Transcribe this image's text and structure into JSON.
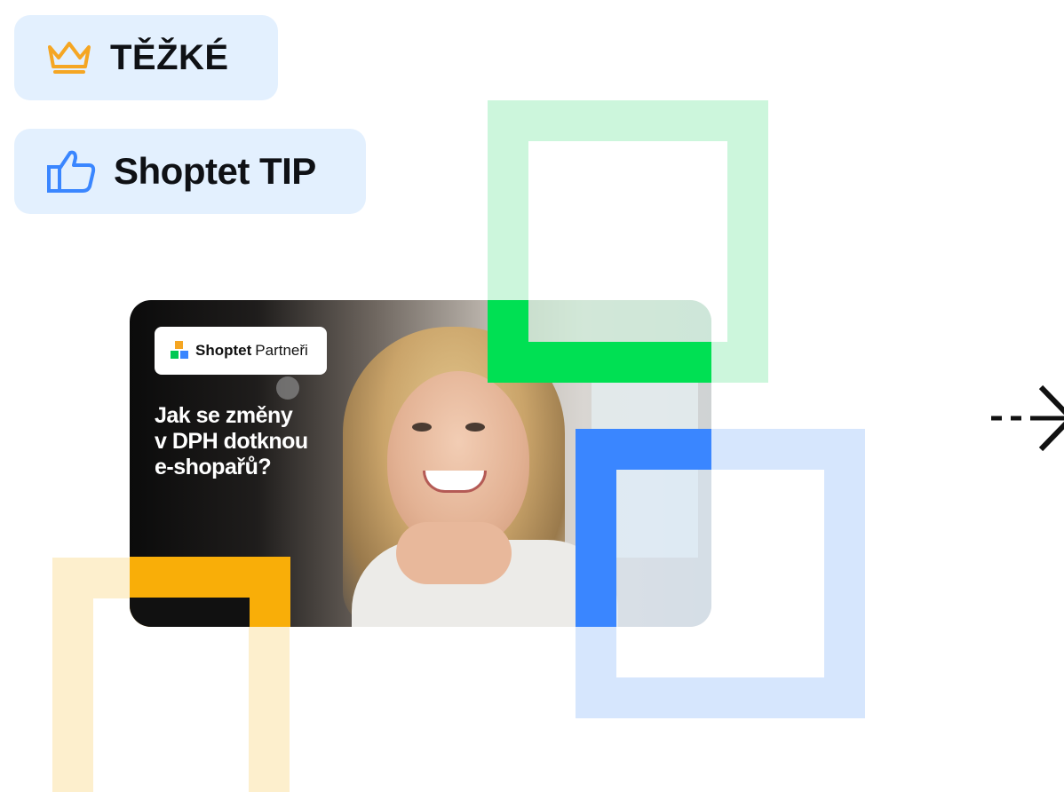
{
  "difficulty_badge": {
    "label": "TĚŽKÉ",
    "icon": "crown-icon",
    "icon_color": "#f5a623"
  },
  "tip_badge": {
    "label": "Shoptet TIP",
    "icon": "thumbs-up-icon",
    "icon_color": "#3a86ff"
  },
  "card": {
    "logo": {
      "brand": "Shoptet",
      "suffix": "Partneři"
    },
    "headline": [
      "Jak se změny",
      "v DPH dotknou",
      "e-shopařů?"
    ]
  },
  "colors": {
    "badge_bg": "#e3f0fe",
    "green": "#00e053",
    "green_light": "#ccf6dc",
    "blue": "#3a86ff",
    "blue_light": "#d6e6fd",
    "yellow": "#f9ae08",
    "yellow_light": "#fdefcd"
  },
  "arrow": {
    "icon": "dashed-arrow-right-icon"
  }
}
